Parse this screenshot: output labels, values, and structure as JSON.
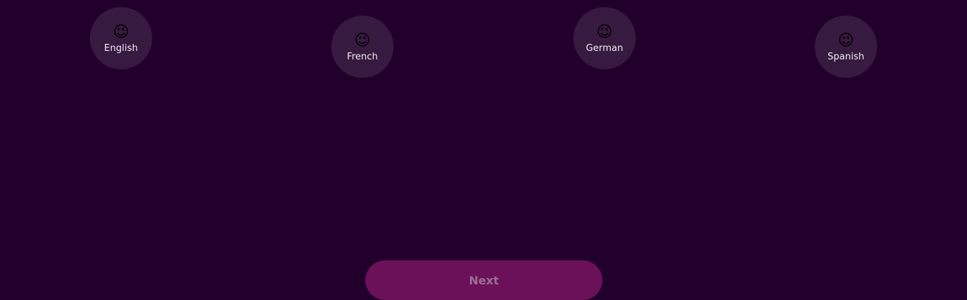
{
  "languages": [
    {
      "label": "English",
      "emoji": "😉",
      "icon": "winking-face-icon"
    },
    {
      "label": "French",
      "emoji": "😉",
      "icon": "winking-face-icon"
    },
    {
      "label": "German",
      "emoji": "😉",
      "icon": "winking-face-icon"
    },
    {
      "label": "Spanish",
      "emoji": "😉",
      "icon": "winking-face-icon"
    }
  ],
  "footer": {
    "next_label": "Next",
    "next_disabled": true
  },
  "colors": {
    "background": "#22002c",
    "option_bg": "#371a3f",
    "button_bg": "#6a1159",
    "button_text": "#9b6e95",
    "label_text": "#f2eaf4"
  }
}
